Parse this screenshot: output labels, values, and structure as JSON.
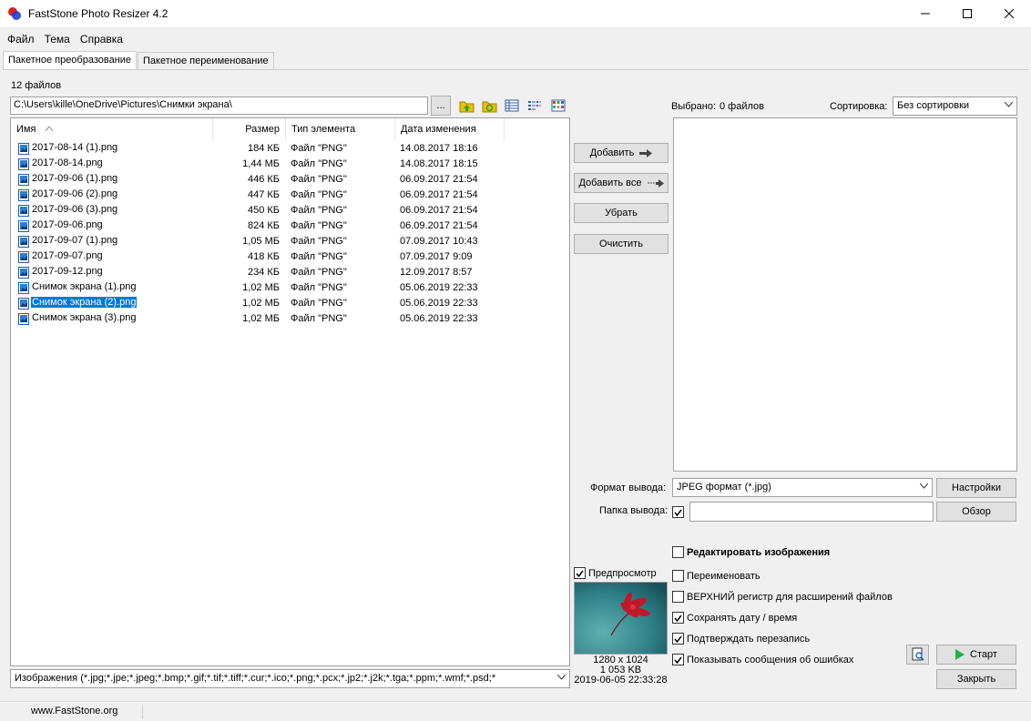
{
  "window": {
    "title": "FastStone Photo Resizer 4.2",
    "minimize_icon": "minimize-icon",
    "maximize_icon": "maximize-icon",
    "close_icon": "close-icon"
  },
  "menu": [
    "Файл",
    "Тема",
    "Справка"
  ],
  "tabs": [
    {
      "label": "Пакетное преобразование",
      "active": true
    },
    {
      "label": "Пакетное переименование",
      "active": false
    }
  ],
  "source": {
    "file_count": "12 файлов",
    "path": "C:\\Users\\kille\\OneDrive\\Pictures\\Снимки экрана\\",
    "browse_label": "...",
    "columns": [
      "Имя",
      "Размер",
      "Тип элемента",
      "Дата изменения"
    ],
    "files": [
      {
        "name": "2017-08-14 (1).png",
        "size": "184 КБ",
        "type": "Файл \"PNG\"",
        "date": "14.08.2017 18:16",
        "selected": false
      },
      {
        "name": "2017-08-14.png",
        "size": "1,44 МБ",
        "type": "Файл \"PNG\"",
        "date": "14.08.2017 18:15",
        "selected": false
      },
      {
        "name": "2017-09-06 (1).png",
        "size": "446 КБ",
        "type": "Файл \"PNG\"",
        "date": "06.09.2017 21:54",
        "selected": false
      },
      {
        "name": "2017-09-06 (2).png",
        "size": "447 КБ",
        "type": "Файл \"PNG\"",
        "date": "06.09.2017 21:54",
        "selected": false
      },
      {
        "name": "2017-09-06 (3).png",
        "size": "450 КБ",
        "type": "Файл \"PNG\"",
        "date": "06.09.2017 21:54",
        "selected": false
      },
      {
        "name": "2017-09-06.png",
        "size": "824 КБ",
        "type": "Файл \"PNG\"",
        "date": "06.09.2017 21:54",
        "selected": false
      },
      {
        "name": "2017-09-07 (1).png",
        "size": "1,05 МБ",
        "type": "Файл \"PNG\"",
        "date": "07.09.2017 10:43",
        "selected": false
      },
      {
        "name": "2017-09-07.png",
        "size": "418 КБ",
        "type": "Файл \"PNG\"",
        "date": "07.09.2017 9:09",
        "selected": false
      },
      {
        "name": "2017-09-12.png",
        "size": "234 КБ",
        "type": "Файл \"PNG\"",
        "date": "12.09.2017 8:57",
        "selected": false
      },
      {
        "name": "Снимок экрана (1).png",
        "size": "1,02 МБ",
        "type": "Файл \"PNG\"",
        "date": "05.06.2019 22:33",
        "selected": false
      },
      {
        "name": "Снимок экрана (2).png",
        "size": "1,02 МБ",
        "type": "Файл \"PNG\"",
        "date": "05.06.2019 22:33",
        "selected": true
      },
      {
        "name": "Снимок экрана (3).png",
        "size": "1,02 МБ",
        "type": "Файл \"PNG\"",
        "date": "05.06.2019 22:33",
        "selected": false
      }
    ],
    "filter": "Изображения (*.jpg;*.jpe;*.jpeg;*.bmp;*.gif;*.tif;*.tiff;*.cur;*.ico;*.png;*.pcx;*.jp2;*.j2k;*.tga;*.ppm;*.wmf;*.psd;*"
  },
  "actions": {
    "add": "Добавить",
    "add_all": "Добавить все",
    "remove": "Убрать",
    "clear": "Очистить"
  },
  "target": {
    "selected_label": "Выбрано:",
    "selected_count": "0 файлов",
    "sort_label": "Сортировка:",
    "sort_value": "Без сортировки"
  },
  "output": {
    "format_label": "Формат вывода:",
    "format_value": "JPEG формат (*.jpg)",
    "settings_button": "Настройки",
    "folder_label": "Папка вывода:",
    "folder_checked": true,
    "folder_value": "",
    "browse_button": "Обзор"
  },
  "preview": {
    "label": "Предпросмотр",
    "checked": true,
    "dimensions": "1280 x 1024",
    "size": "1 053 KB",
    "datetime": "2019-06-05 22:33:28"
  },
  "options": [
    {
      "label": "Редактировать изображения",
      "checked": false,
      "bold": true
    },
    {
      "label": "Переименовать",
      "checked": false,
      "bold": false
    },
    {
      "label": "ВЕРХНИЙ регистр для расширений файлов",
      "checked": false,
      "bold": false
    },
    {
      "label": "Сохранять дату / время",
      "checked": true,
      "bold": false
    },
    {
      "label": "Подтверждать перезапись",
      "checked": true,
      "bold": false
    },
    {
      "label": "Показывать сообщения об ошибках",
      "checked": true,
      "bold": false
    }
  ],
  "buttons": {
    "start": "Старт",
    "close": "Закрыть"
  },
  "status": {
    "website": "www.FastStone.org"
  },
  "colors": {
    "selection": "#0078d7",
    "folder_icon": "#e8c000",
    "start_icon": "#22b14c"
  }
}
